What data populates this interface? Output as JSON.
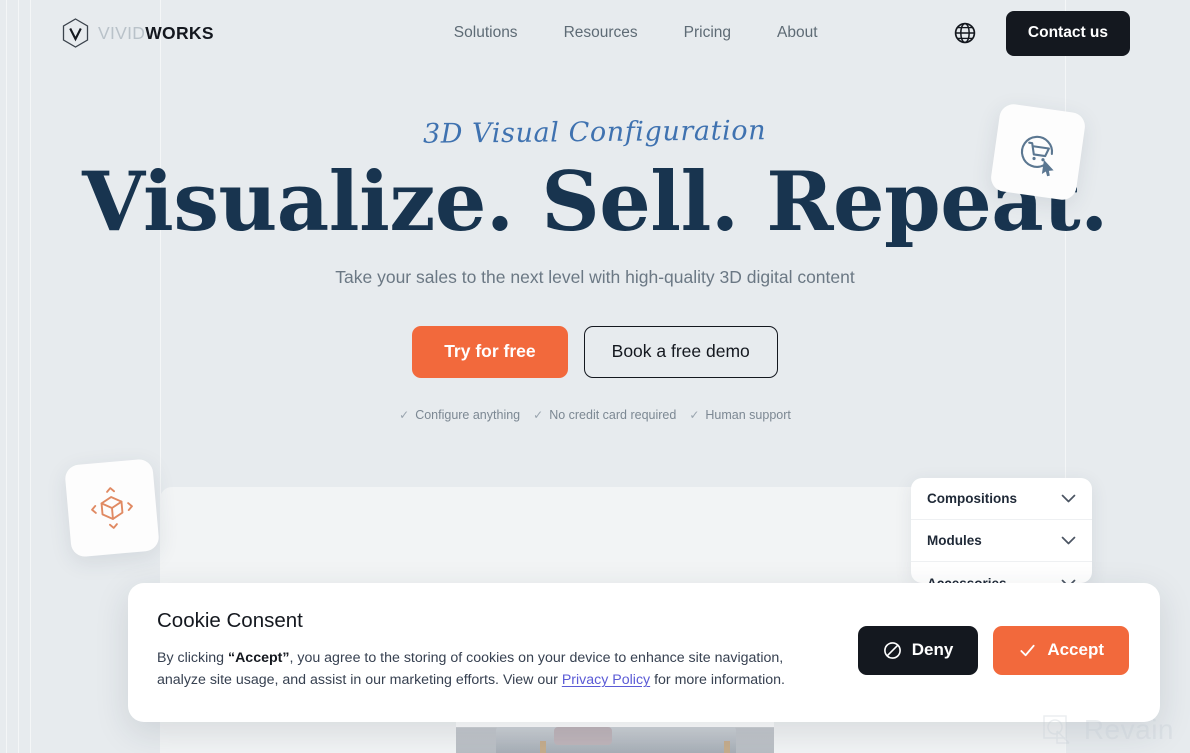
{
  "colors": {
    "background": "#e7ebee",
    "accent_orange": "#f2693c",
    "dark": "#14181f",
    "headline_navy": "#18344f",
    "eyebrow_blue": "#3f72b0",
    "link_purple": "#5b5bd6"
  },
  "header": {
    "logo": {
      "icon": "vividworks-hex-v-logo",
      "text_light": "VIVID",
      "text_bold": "WORKS"
    },
    "nav": [
      {
        "label": "Solutions"
      },
      {
        "label": "Resources"
      },
      {
        "label": "Pricing"
      },
      {
        "label": "About"
      }
    ],
    "language_icon": "globe-icon",
    "contact_label": "Contact us"
  },
  "hero": {
    "eyebrow": "3D Visual Configuration",
    "headline": "Visualize. Sell. Repeat.",
    "subhead": "Take your sales to the next level with high-quality 3D digital content",
    "primary_cta": "Try for free",
    "secondary_cta": "Book a free demo",
    "features": [
      {
        "tick": "✓",
        "label": "Configure anything"
      },
      {
        "tick": "✓",
        "label": "No credit card required"
      },
      {
        "tick": "✓",
        "label": "Human support"
      }
    ]
  },
  "decorations": {
    "cart_card_icon": "cart-cursor-icon",
    "cube_card_icon": "3d-cube-arrows-icon"
  },
  "configurator": {
    "rows": [
      {
        "label": "Compositions",
        "icon": "chevron-down-icon"
      },
      {
        "label": "Modules",
        "icon": "chevron-down-icon"
      },
      {
        "label": "Accessories",
        "icon": "chevron-down-icon"
      }
    ]
  },
  "cookie_consent": {
    "title": "Cookie Consent",
    "body_part1": "By clicking ",
    "body_bold": "“Accept”",
    "body_part2": ", you agree to the storing of cookies on your device to enhance site navigation, analyze site usage, and assist in our marketing efforts. View our ",
    "link_label": "Privacy Policy",
    "body_part3": " for more information.",
    "deny_label": "Deny",
    "deny_icon": "block-circle-slash-icon",
    "accept_label": "Accept",
    "accept_icon": "check-icon"
  },
  "watermark": {
    "label": "Revain",
    "icon": "revain-logo-icon"
  }
}
